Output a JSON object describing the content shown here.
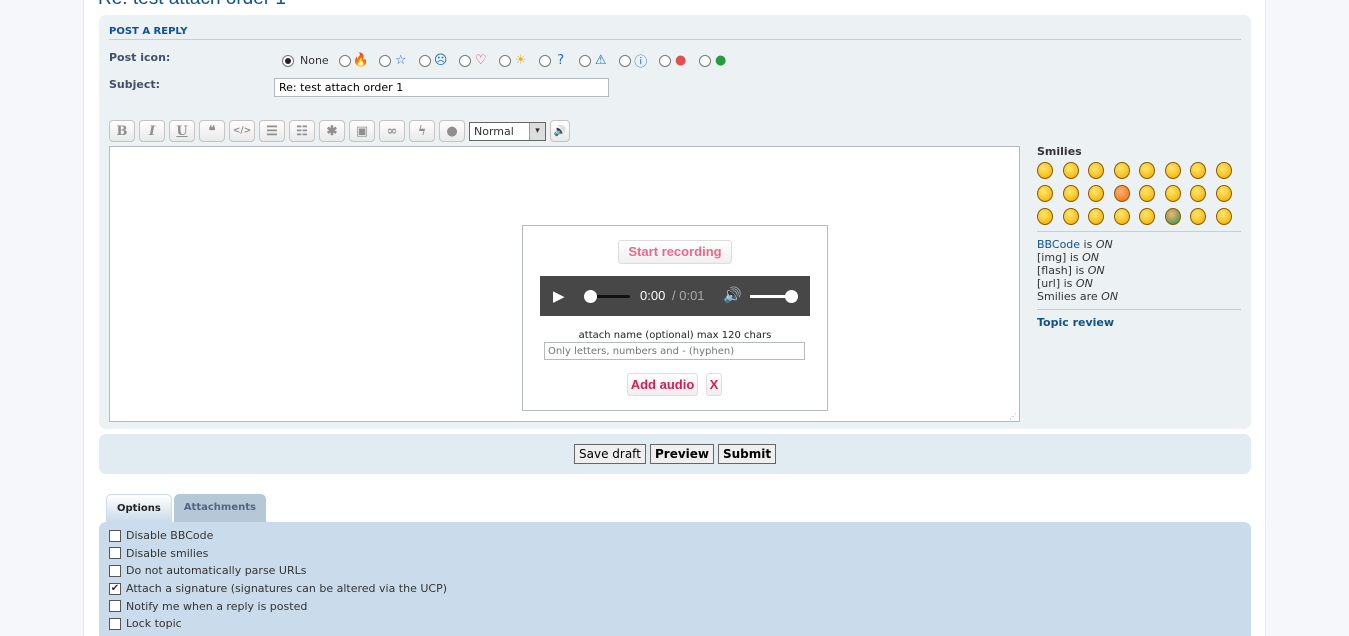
{
  "page_title": "Re: test attach order 1",
  "panel_header": "POST A REPLY",
  "post_icon_label": "Post icon:",
  "post_icons": [
    {
      "name": "none",
      "label": "None",
      "selected": true
    },
    {
      "name": "fire-icon",
      "glyph": "🔥",
      "color": "#f08030"
    },
    {
      "name": "star-icon",
      "glyph": "☆",
      "color": "#1a6fc4"
    },
    {
      "name": "sad-icon",
      "glyph": "☹",
      "color": "#1a6fc4"
    },
    {
      "name": "heart-icon",
      "glyph": "♡",
      "color": "#d0304a"
    },
    {
      "name": "lightbulb-icon",
      "glyph": "☀",
      "color": "#f0b020"
    },
    {
      "name": "question-icon",
      "glyph": "?",
      "color": "#1a6fc4"
    },
    {
      "name": "warning-icon",
      "glyph": "⚠",
      "color": "#1a6fc4"
    },
    {
      "name": "info-icon",
      "glyph": "ⓘ",
      "color": "#1a6fc4"
    },
    {
      "name": "red-face-icon",
      "glyph": "●",
      "color": "#e05050"
    },
    {
      "name": "green-grin-icon",
      "glyph": "●",
      "color": "#2a9a40"
    }
  ],
  "subject_label": "Subject:",
  "subject_value": "Re: test attach order 1",
  "toolbar": [
    {
      "name": "bold",
      "glyph": "B"
    },
    {
      "name": "italic",
      "glyph": "I"
    },
    {
      "name": "underline",
      "glyph": "U"
    },
    {
      "name": "quote",
      "glyph": "❝"
    },
    {
      "name": "code",
      "glyph": "</>"
    },
    {
      "name": "list",
      "glyph": "☰"
    },
    {
      "name": "ordered-list",
      "glyph": "☷"
    },
    {
      "name": "list-item",
      "glyph": "✱"
    },
    {
      "name": "image",
      "glyph": "▣"
    },
    {
      "name": "link",
      "glyph": "∞"
    },
    {
      "name": "flash",
      "glyph": "ϟ"
    },
    {
      "name": "color",
      "glyph": "●"
    }
  ],
  "font_size_select": "Normal",
  "recorder": {
    "start": "Start recording",
    "time_current": "0:00",
    "time_total": "/ 0:01",
    "attach_name_label": "attach name (optional) max 120 chars",
    "attach_name_placeholder": "Only letters, numbers and - (hyphen)",
    "add_audio": "Add audio",
    "close": "X",
    "progress": 0,
    "volume": 1
  },
  "sidebar": {
    "smilies_title": "Smilies",
    "smilies_count": 24,
    "bbcode_link": "BBCode",
    "bbcode_status": " is ",
    "on": "ON",
    "img": "[img] is ",
    "flash": "[flash] is ",
    "url": "[url] is ",
    "smilies": "Smilies are ",
    "topic_review": "Topic review"
  },
  "buttons": {
    "save_draft": "Save draft",
    "preview": "Preview",
    "submit": "Submit"
  },
  "tabs": [
    {
      "label": "Options",
      "active": true
    },
    {
      "label": "Attachments",
      "active": false
    }
  ],
  "options": [
    {
      "label": "Disable BBCode",
      "checked": false
    },
    {
      "label": "Disable smilies",
      "checked": false
    },
    {
      "label": "Do not automatically parse URLs",
      "checked": false
    },
    {
      "label": "Attach a signature (signatures can be altered via the UCP)",
      "checked": true
    },
    {
      "label": "Notify me when a reply is posted",
      "checked": false
    },
    {
      "label": "Lock topic",
      "checked": false
    }
  ]
}
